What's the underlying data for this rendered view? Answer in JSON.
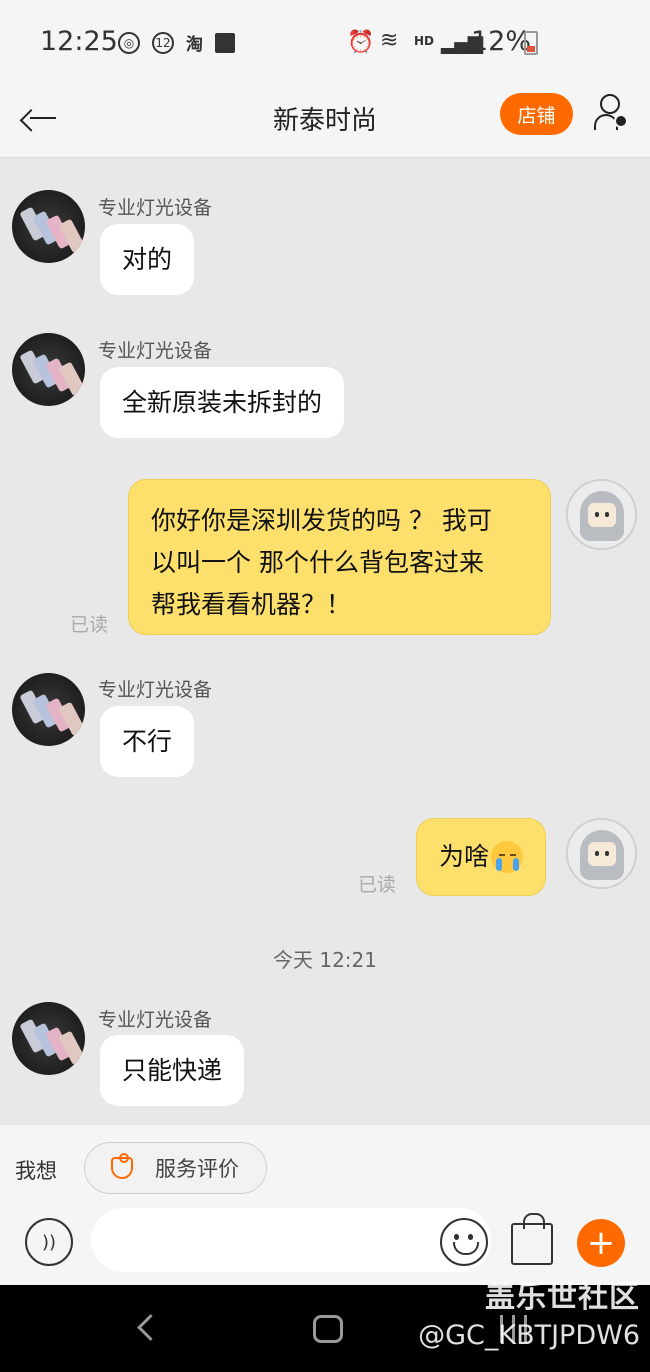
{
  "status_bar": {
    "time": "12:25",
    "left_icons": [
      "app-circle-icon",
      "badge-12-icon",
      "taobao-icon",
      "image-icon"
    ],
    "badge_number": "12",
    "taobao_glyph": "淘",
    "network_label": "HD",
    "battery": "12%"
  },
  "header": {
    "title": "新泰时尚",
    "store_label": "店铺"
  },
  "chat": {
    "messages": [
      {
        "side": "left",
        "sender": "专业灯光设备",
        "text": "对的"
      },
      {
        "side": "left",
        "sender": "专业灯光设备",
        "text": "全新原装未拆封的"
      },
      {
        "side": "right",
        "lines": [
          "你好你是深圳发货的吗 ？ 我可",
          "以叫一个 那个什么背包客过来",
          "帮我看看机器？！"
        ],
        "status": "已读"
      },
      {
        "side": "left",
        "sender": "专业灯光设备",
        "text": "不行"
      },
      {
        "side": "right",
        "text": "为啥",
        "emoji": "crying-face-icon",
        "status": "已读"
      },
      {
        "side": "left",
        "sender": "专业灯光设备",
        "text": "只能快递"
      }
    ],
    "time_divider": "今天  12:21"
  },
  "suggest": {
    "label": "我想",
    "chip_label": "服务评价"
  },
  "input": {
    "placeholder": "",
    "value": ""
  },
  "watermark": {
    "line1": "盖乐世社区",
    "line2": "@GC_KBTJPDW6"
  },
  "colors": {
    "accent": "#ff6a00",
    "my_bubble": "#fde06c",
    "chat_bg": "#e8e8e8"
  }
}
